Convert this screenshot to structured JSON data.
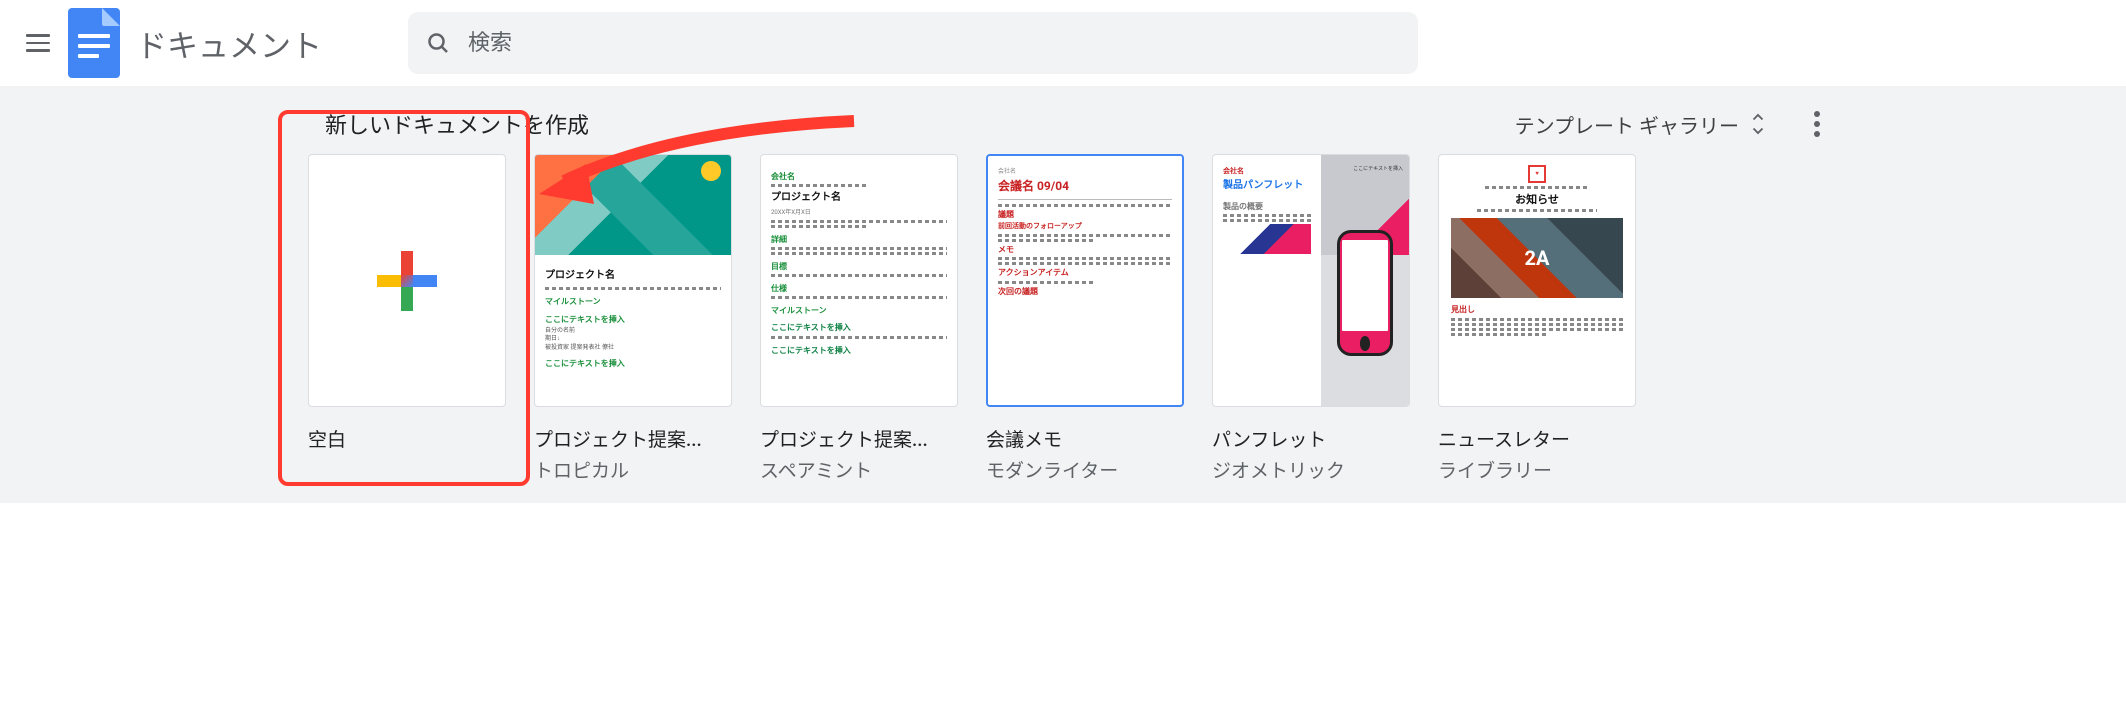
{
  "header": {
    "app_title": "ドキュメント",
    "search_placeholder": "検索"
  },
  "template_section": {
    "title": "新しいドキュメントを作成",
    "gallery_label": "テンプレート ギャラリー"
  },
  "templates": [
    {
      "title": "空白",
      "subtitle": ""
    },
    {
      "title": "プロジェクト提案...",
      "subtitle": "トロピカル"
    },
    {
      "title": "プロジェクト提案...",
      "subtitle": "スペアミント"
    },
    {
      "title": "会議メモ",
      "subtitle": "モダンライター"
    },
    {
      "title": "パンフレット",
      "subtitle": "ジオメトリック"
    },
    {
      "title": "ニュースレター",
      "subtitle": "ライブラリー"
    }
  ],
  "thumb_text": {
    "tropical_project": "プロジェクト名",
    "spearmint_company": "会社名",
    "spearmint_project": "プロジェクト名",
    "meeting_company": "会社名",
    "meeting_title": "会議名 09/04",
    "brochure_company": "会社名",
    "brochure_title": "製品パンフレット",
    "brochure_overview": "製品の概要",
    "newsletter_title": "お知らせ"
  },
  "colors": {
    "accent": "#4285f4",
    "annotation": "#ff3b2f"
  }
}
